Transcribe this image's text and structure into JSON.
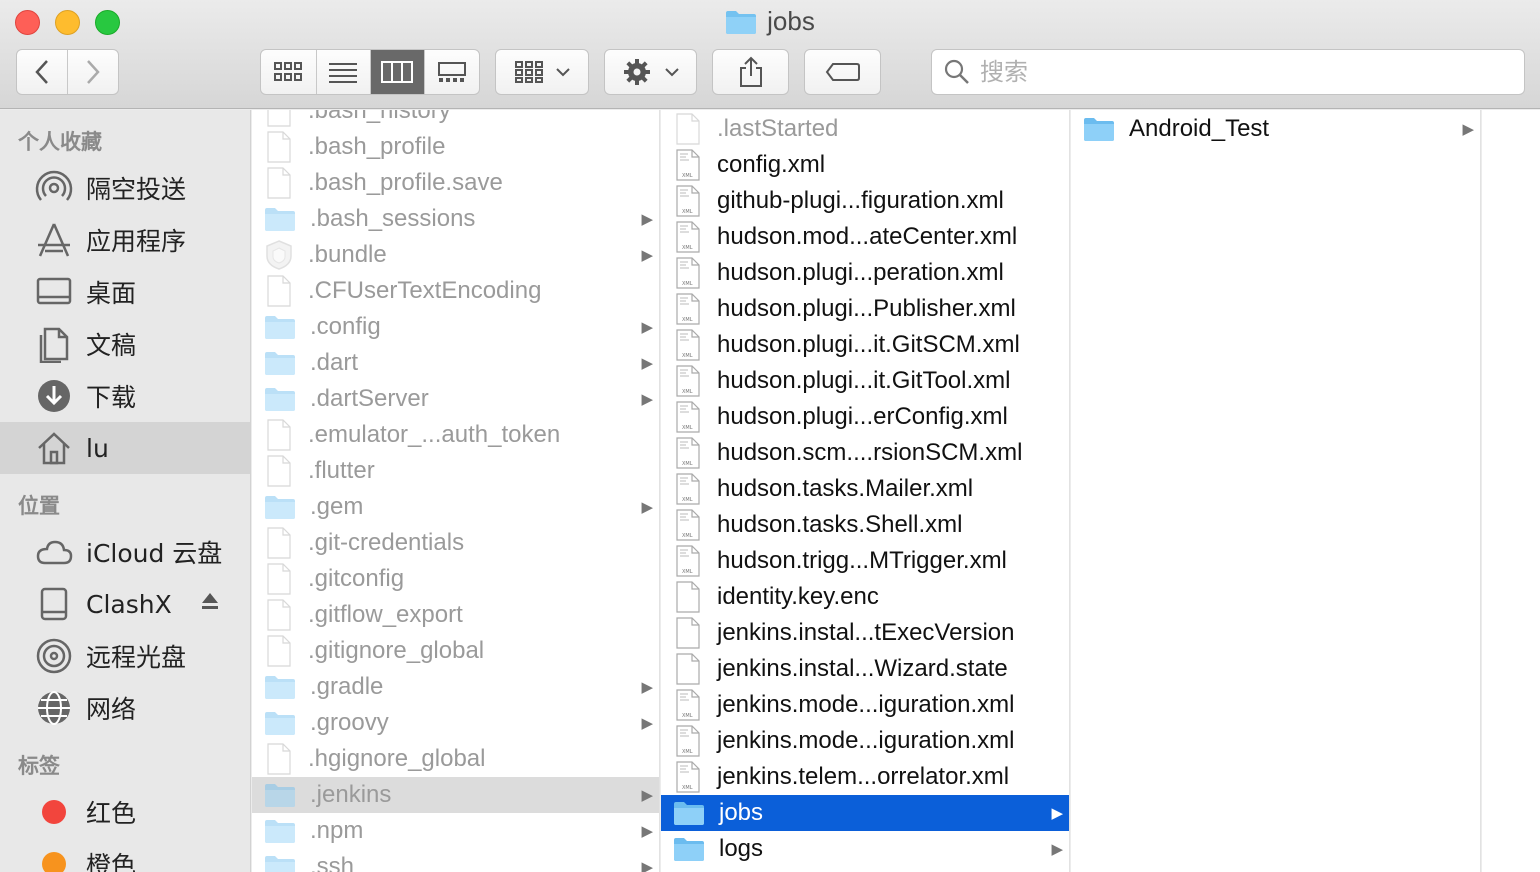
{
  "window": {
    "title": "jobs"
  },
  "toolbar": {
    "search_placeholder": "搜索",
    "view_mode_selected": "column"
  },
  "sidebar": {
    "sections": [
      {
        "title": "个人收藏",
        "items": [
          {
            "label": "隔空投送",
            "icon": "airdrop-icon"
          },
          {
            "label": "应用程序",
            "icon": "applications-icon"
          },
          {
            "label": "桌面",
            "icon": "desktop-icon"
          },
          {
            "label": "文稿",
            "icon": "documents-icon"
          },
          {
            "label": "下载",
            "icon": "downloads-icon"
          },
          {
            "label": "lu",
            "icon": "home-icon",
            "selected": true
          }
        ]
      },
      {
        "title": "位置",
        "items": [
          {
            "label": "iCloud 云盘",
            "icon": "icloud-icon"
          },
          {
            "label": "ClashX",
            "icon": "disk-icon",
            "eject": true
          },
          {
            "label": "远程光盘",
            "icon": "remote-disc-icon"
          },
          {
            "label": "网络",
            "icon": "network-icon"
          }
        ]
      },
      {
        "title": "标签",
        "items": [
          {
            "label": "红色",
            "color": "#f2453d"
          },
          {
            "label": "橙色",
            "color": "#f7931e"
          }
        ]
      }
    ]
  },
  "columns": [
    {
      "items": [
        {
          "name": ".bash_history",
          "kind": "file",
          "dim": true
        },
        {
          "name": ".bash_profile",
          "kind": "file",
          "dim": true
        },
        {
          "name": ".bash_profile.save",
          "kind": "file",
          "dim": true
        },
        {
          "name": ".bash_sessions",
          "kind": "folder",
          "dim": true
        },
        {
          "name": ".bundle",
          "kind": "bundle",
          "dim": true
        },
        {
          "name": ".CFUserTextEncoding",
          "kind": "file",
          "dim": true
        },
        {
          "name": ".config",
          "kind": "folder",
          "dim": true
        },
        {
          "name": ".dart",
          "kind": "folder",
          "dim": true
        },
        {
          "name": ".dartServer",
          "kind": "folder",
          "dim": true
        },
        {
          "name": ".emulator_...auth_token",
          "kind": "file",
          "dim": true
        },
        {
          "name": ".flutter",
          "kind": "file",
          "dim": true
        },
        {
          "name": ".gem",
          "kind": "folder",
          "dim": true
        },
        {
          "name": ".git-credentials",
          "kind": "file",
          "dim": true
        },
        {
          "name": ".gitconfig",
          "kind": "file",
          "dim": true
        },
        {
          "name": ".gitflow_export",
          "kind": "file",
          "dim": true
        },
        {
          "name": ".gitignore_global",
          "kind": "file",
          "dim": true
        },
        {
          "name": ".gradle",
          "kind": "folder",
          "dim": true
        },
        {
          "name": ".groovy",
          "kind": "folder",
          "dim": true
        },
        {
          "name": ".hgignore_global",
          "kind": "file",
          "dim": true
        },
        {
          "name": ".jenkins",
          "kind": "folder",
          "dim": true,
          "selected": "grey"
        },
        {
          "name": ".npm",
          "kind": "folder",
          "dim": true
        },
        {
          "name": ".ssh",
          "kind": "folder",
          "dim": true
        }
      ]
    },
    {
      "items": [
        {
          "name": ".lastStarted",
          "kind": "file",
          "dim": true
        },
        {
          "name": "config.xml",
          "kind": "xml"
        },
        {
          "name": "github-plugi...figuration.xml",
          "kind": "xml"
        },
        {
          "name": "hudson.mod...ateCenter.xml",
          "kind": "xml"
        },
        {
          "name": "hudson.plugi...peration.xml",
          "kind": "xml"
        },
        {
          "name": "hudson.plugi...Publisher.xml",
          "kind": "xml"
        },
        {
          "name": "hudson.plugi...it.GitSCM.xml",
          "kind": "xml"
        },
        {
          "name": "hudson.plugi...it.GitTool.xml",
          "kind": "xml"
        },
        {
          "name": "hudson.plugi...erConfig.xml",
          "kind": "xml"
        },
        {
          "name": "hudson.scm....rsionSCM.xml",
          "kind": "xml"
        },
        {
          "name": "hudson.tasks.Mailer.xml",
          "kind": "xml"
        },
        {
          "name": "hudson.tasks.Shell.xml",
          "kind": "xml"
        },
        {
          "name": "hudson.trigg...MTrigger.xml",
          "kind": "xml"
        },
        {
          "name": "identity.key.enc",
          "kind": "file"
        },
        {
          "name": "jenkins.instal...tExecVersion",
          "kind": "file"
        },
        {
          "name": "jenkins.instal...Wizard.state",
          "kind": "file"
        },
        {
          "name": "jenkins.mode...iguration.xml",
          "kind": "xml"
        },
        {
          "name": "jenkins.mode...iguration.xml",
          "kind": "xml"
        },
        {
          "name": "jenkins.telem...orrelator.xml",
          "kind": "xml"
        },
        {
          "name": "jobs",
          "kind": "folder",
          "selected": "blue"
        },
        {
          "name": "logs",
          "kind": "folder"
        }
      ]
    },
    {
      "items": [
        {
          "name": "Android_Test",
          "kind": "folder"
        }
      ]
    }
  ]
}
